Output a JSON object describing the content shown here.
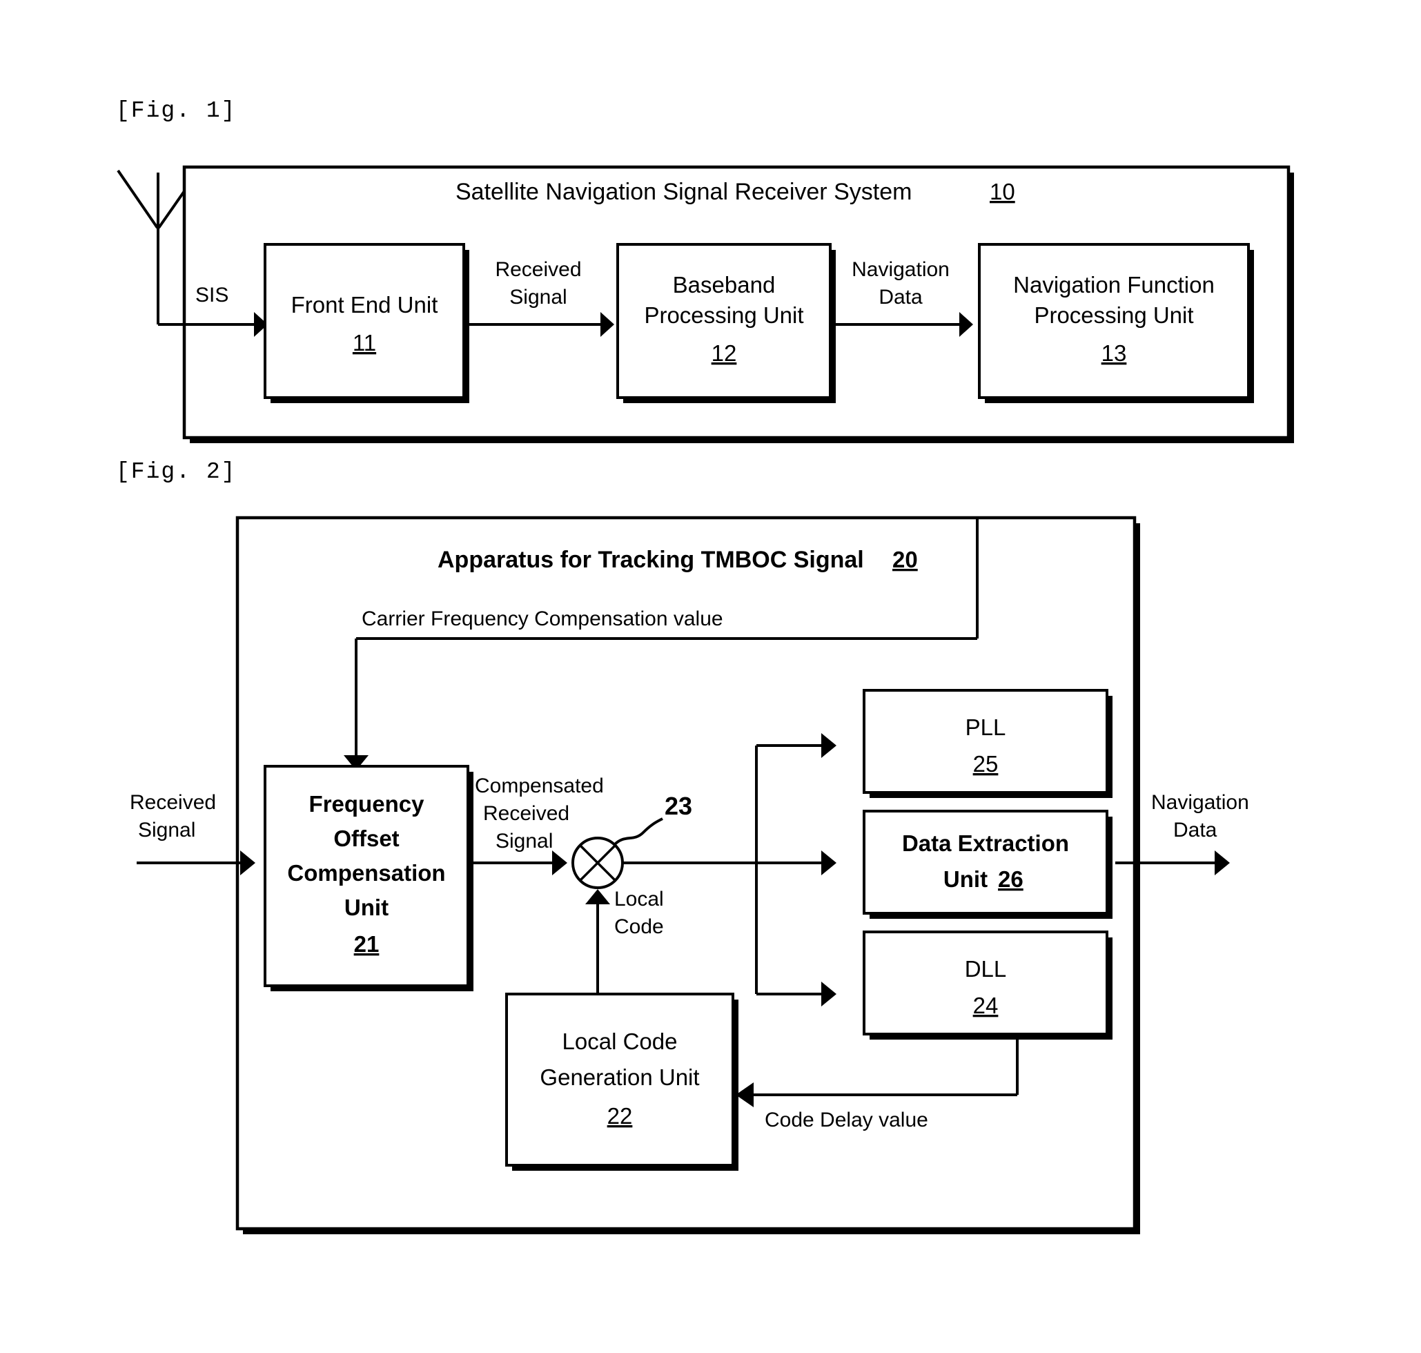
{
  "figures": [
    {
      "label": "[Fig. 1]",
      "title": "Satellite Navigation Signal Receiver System",
      "title_ref": "10",
      "antenna_icon": "antenna-icon",
      "blocks": [
        {
          "name": "front-end-unit",
          "label": "Front End Unit",
          "ref": "11"
        },
        {
          "name": "baseband-processing-unit",
          "label_line1": "Baseband",
          "label_line2": "Processing Unit",
          "ref": "12"
        },
        {
          "name": "navigation-function-processing-unit",
          "label_line1": "Navigation Function",
          "label_line2": "Processing Unit",
          "ref": "13"
        }
      ],
      "edge_labels": [
        {
          "name": "sis-label",
          "text": "SIS"
        },
        {
          "name": "received-signal-label",
          "line1": "Received",
          "line2": "Signal"
        },
        {
          "name": "navigation-data-label",
          "line1": "Navigation",
          "line2": "Data"
        }
      ]
    },
    {
      "label": "[Fig. 2]",
      "title": "Apparatus for Tracking TMBOC Signal",
      "title_ref": "20",
      "blocks": [
        {
          "name": "frequency-offset-compensation-unit",
          "label_line1": "Frequency",
          "label_line2": "Offset",
          "label_line3": "Compensation",
          "label_line4": "Unit",
          "ref": "21"
        },
        {
          "name": "local-code-generation-unit",
          "label_line1": "Local Code",
          "label_line2": "Generation Unit",
          "ref": "22"
        },
        {
          "name": "pll-unit",
          "label": "PLL",
          "ref": "25"
        },
        {
          "name": "data-extraction-unit",
          "label_line1": "Data Extraction",
          "label_line2": "Unit",
          "ref": "26"
        },
        {
          "name": "dll-unit",
          "label": "DLL",
          "ref": "24"
        }
      ],
      "mixer": {
        "name": "mixer-node",
        "ref": "23"
      },
      "edge_labels": [
        {
          "name": "carrier-frequency-compensation-value-label",
          "text": "Carrier Frequency Compensation value"
        },
        {
          "name": "received-signal-input-label",
          "line1": "Received",
          "line2": "Signal"
        },
        {
          "name": "compensated-received-signal-label",
          "line1": "Compensated",
          "line2": "Received",
          "line3": "Signal"
        },
        {
          "name": "local-code-label",
          "line1": "Local",
          "line2": "Code"
        },
        {
          "name": "code-delay-value-label",
          "text": "Code Delay value"
        },
        {
          "name": "navigation-data-output-label",
          "line1": "Navigation",
          "line2": "Data"
        }
      ]
    }
  ]
}
